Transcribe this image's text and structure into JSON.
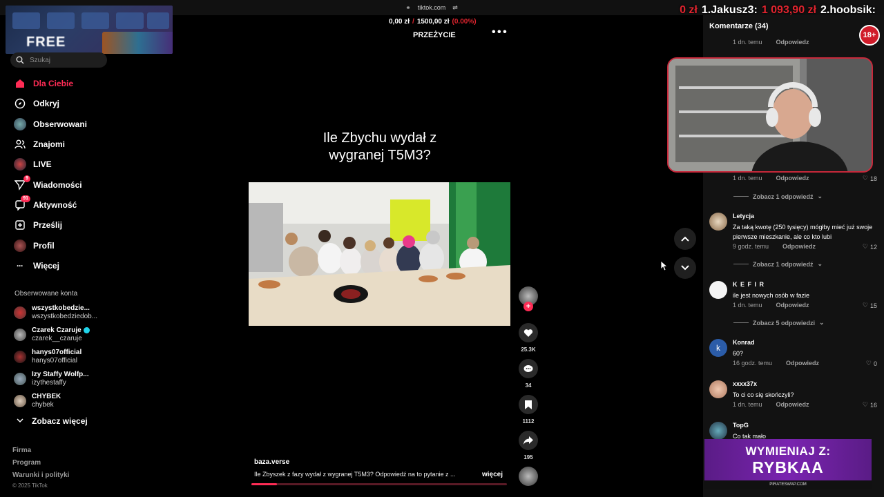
{
  "browser": {
    "url": "tiktok.com"
  },
  "overlay": {
    "top_score_prefix": "0 zł",
    "leader1_label": "1.Jakusz3:",
    "leader1_value": "1 093,90 zł",
    "leader2_label": "2.hoobsik:",
    "progress_current": "0,00 zł",
    "progress_sep": "/",
    "progress_goal": "1500,00 zł",
    "progress_pct": "(0.00%)",
    "category": "PRZEŻYCIE",
    "promo_text": "FREE",
    "age_badge": "18+",
    "swap_line1": "WYMIENIAJ Z:",
    "swap_line2": "RYBKAA",
    "swap_site": "PIRATESWAP.COM"
  },
  "sidebar": {
    "search_placeholder": "Szukaj",
    "nav": [
      {
        "label": "Dla Ciebie",
        "icon": "home-icon"
      },
      {
        "label": "Odkryj",
        "icon": "compass-icon"
      },
      {
        "label": "Obserwowani",
        "icon": "following-avatar-icon"
      },
      {
        "label": "Znajomi",
        "icon": "friends-icon"
      },
      {
        "label": "LIVE",
        "icon": "live-icon"
      },
      {
        "label": "Wiadomości",
        "icon": "messages-icon",
        "badge": "9"
      },
      {
        "label": "Aktywność",
        "icon": "activity-icon",
        "badge": "91"
      },
      {
        "label": "Prześlij",
        "icon": "upload-icon"
      },
      {
        "label": "Profil",
        "icon": "profile-icon"
      },
      {
        "label": "Więcej",
        "icon": "more-icon"
      }
    ],
    "following_title": "Obserwowane konta",
    "accounts": [
      {
        "name": "wszystkobedzie...",
        "handle": "wszystkobedziedob..."
      },
      {
        "name": "Czarek Czaruje",
        "handle": "czarek__czaruje",
        "verified": true
      },
      {
        "name": "hanys07official",
        "handle": "hanys07official"
      },
      {
        "name": "Izy Staffy Wolfp...",
        "handle": "izythestaffy"
      },
      {
        "name": "CHYBEK",
        "handle": "chybek"
      }
    ],
    "see_more": "Zobacz więcej",
    "footer": [
      "Firma",
      "Program",
      "Warunki i polityki"
    ],
    "copyright": "© 2025 TikTok"
  },
  "video": {
    "title_line1": "Ile Zbychu wydał z",
    "title_line2": "wygranej T5M3?",
    "author": "baza.verse",
    "caption": "Ile Zbyszek z fazy wydał z wygranej T5M3? Odpowiedź na to pytanie z ...",
    "more": "więcej",
    "progress": 0.1
  },
  "actions": {
    "likes": "25.3K",
    "comments": "34",
    "saves": "1112",
    "shares": "195"
  },
  "comments_panel": {
    "header": "Komentarze (34)",
    "items": [
      {
        "time": "1 dn. temu",
        "reply": "Odpowiedz"
      },
      {
        "time": "1 dn. temu",
        "reply": "Odpowiedz",
        "likes": "18",
        "see_replies": "Zobacz 1 odpowiedź"
      },
      {
        "user": "Letycja",
        "text": "Za taką kwotę (250 tysięcy) mógłby mieć już swoje pierwsze mieszkanie, ale co kto lubi",
        "time": "9 godz. temu",
        "reply": "Odpowiedz",
        "likes": "12",
        "see_replies": "Zobacz 1 odpowiedź"
      },
      {
        "user": "K E F I R",
        "text": "ile jest nowych osób w fazie",
        "time": "1 dn. temu",
        "reply": "Odpowiedz",
        "likes": "15",
        "see_replies": "Zobacz 5 odpowiedzi"
      },
      {
        "user": "Konrad",
        "text": "60?",
        "time": "16 godz. temu",
        "reply": "Odpowiedz",
        "likes": "0",
        "avatar_letter": "k"
      },
      {
        "user": "xxxx37x",
        "text": "To ci co się skończyli?",
        "time": "1 dn. temu",
        "reply": "Odpowiedz",
        "likes": "16"
      },
      {
        "user": "TopG",
        "text": "Co tak mało"
      }
    ]
  },
  "colors": {
    "accent": "#fe2c55",
    "overlay_red": "#e0242e",
    "verified": "#20d5ec"
  }
}
